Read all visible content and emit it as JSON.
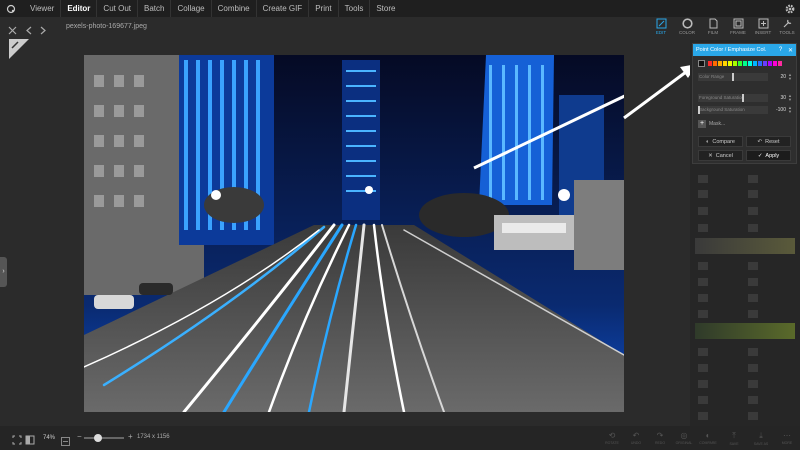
{
  "menu": {
    "items": [
      "Viewer",
      "Editor",
      "Cut Out",
      "Batch",
      "Collage",
      "Combine",
      "Create GIF",
      "Print",
      "Tools",
      "Store"
    ],
    "active": "Editor"
  },
  "file": {
    "name": "pexels-photo-169677.jpeg"
  },
  "tools": [
    {
      "label": "EDIT",
      "icon": "edit-icon",
      "active": true
    },
    {
      "label": "COLOR",
      "icon": "color-icon",
      "active": false
    },
    {
      "label": "FILM",
      "icon": "film-icon",
      "active": false
    },
    {
      "label": "FRAME",
      "icon": "frame-icon",
      "active": false
    },
    {
      "label": "INSERT",
      "icon": "insert-icon",
      "active": false
    },
    {
      "label": "TOOLS",
      "icon": "tools-icon",
      "active": false
    }
  ],
  "popup": {
    "title": "Point Color / Emphasize Col.",
    "help": "?",
    "close": "✕",
    "swatches": [
      "#ff2a2a",
      "#ff6a00",
      "#ffaa00",
      "#ffd500",
      "#e8ff00",
      "#a6ff00",
      "#33ff33",
      "#00ff8c",
      "#00ffe1",
      "#00b4ff",
      "#2a6bff",
      "#6a3cff",
      "#b000ff",
      "#ff00d4",
      "#ff2aa0"
    ],
    "color_range": {
      "label": "Color Range",
      "value": "20",
      "level_pct": 50
    },
    "fg_saturation": {
      "label": "Foreground Saturation",
      "value": "30",
      "level_pct": 65
    },
    "bg_saturation": {
      "label": "Background Saturation",
      "value": "-100",
      "level_pct": 0
    },
    "mask_label": "Mask...",
    "buttons": {
      "compare": "Compare",
      "reset": "Reset",
      "cancel": "Cancel",
      "apply": "Apply"
    }
  },
  "zoom": {
    "percent": "74%",
    "level_pct": 30
  },
  "image": {
    "dimensions": "1734 x 1156"
  },
  "bottom_icons": [
    "ROTATE",
    "UNDO",
    "REDO",
    "ORIGINAL",
    "COMPARE",
    "SAVE",
    "SAVE AS",
    "MORE"
  ],
  "colors": {
    "accent": "#2aa7e8",
    "bg": "#2b2b2b",
    "menubar": "#1f1f1f"
  }
}
